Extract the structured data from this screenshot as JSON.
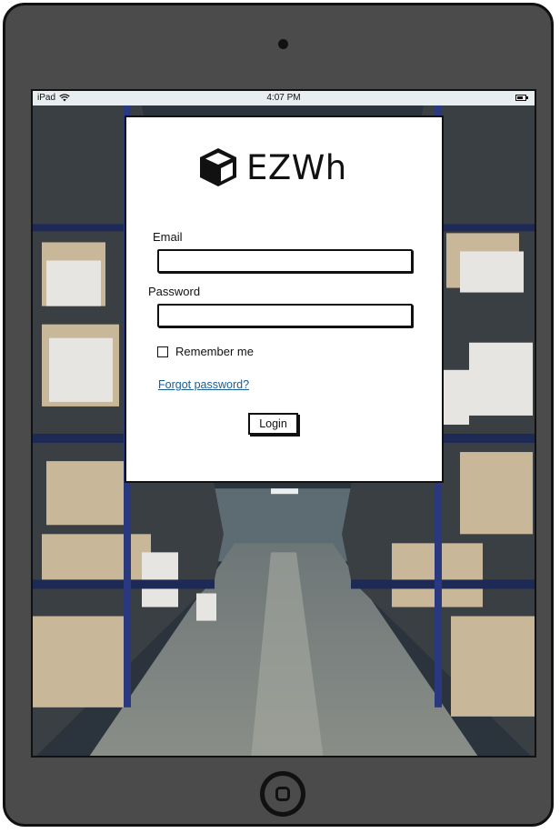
{
  "status_bar": {
    "device": "iPad",
    "time": "4:07 PM",
    "battery_level": 0.8
  },
  "logo": {
    "text": "EZWh",
    "icon": "box-icon"
  },
  "form": {
    "email_label": "Email",
    "email_value": "",
    "password_label": "Password",
    "password_value": "",
    "remember_label": "Remember me",
    "remember_checked": false,
    "forgot_link": "Forgot password?",
    "login_button": "Login"
  },
  "colors": {
    "frame": "#4b4b4b",
    "link": "#1a5d95"
  }
}
